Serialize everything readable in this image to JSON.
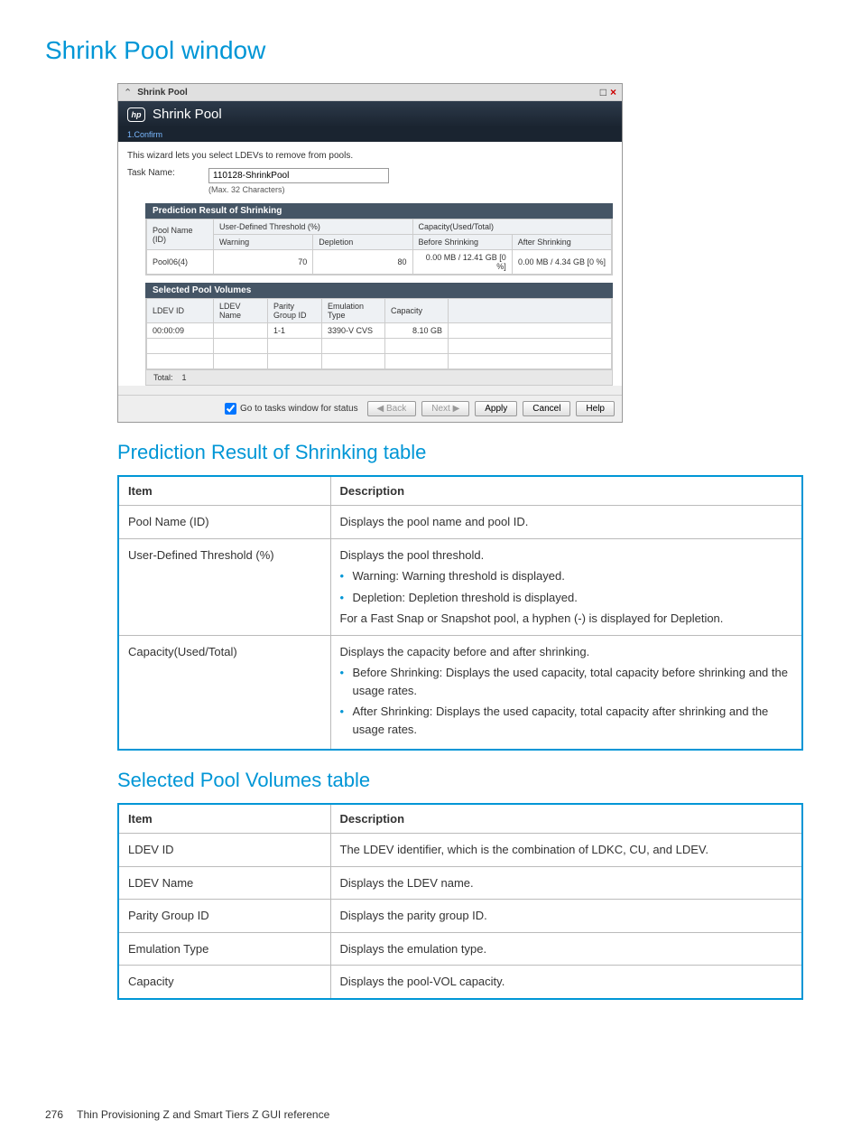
{
  "page": {
    "title": "Shrink Pool window",
    "section1_title": "Prediction Result of Shrinking table",
    "section2_title": "Selected Pool Volumes table",
    "footer_page": "276",
    "footer_text": "Thin Provisioning Z and Smart Tiers Z GUI reference"
  },
  "wizard": {
    "titlebar_text": "Shrink Pool",
    "brand_text": "Shrink Pool",
    "step_label": "1.Confirm",
    "instruction": "This wizard lets you select LDEVs to remove from pools.",
    "task_name_label": "Task Name:",
    "task_name_value": "110128-ShrinkPool",
    "task_name_hint": "(Max. 32 Characters)",
    "prediction": {
      "header": "Prediction Result of Shrinking",
      "col_pool_name": "Pool Name (ID)",
      "col_user_thresh": "User-Defined Threshold (%)",
      "col_warning": "Warning",
      "col_depletion": "Depletion",
      "col_capacity": "Capacity(Used/Total)",
      "col_before": "Before Shrinking",
      "col_after": "After Shrinking",
      "row": {
        "pool": "Pool06(4)",
        "warning": "70",
        "depletion": "80",
        "before": "0.00 MB / 12.41 GB [0 %]",
        "after": "0.00 MB / 4.34 GB [0 %]"
      }
    },
    "selected": {
      "header": "Selected Pool Volumes",
      "col_ldev_id": "LDEV ID",
      "col_ldev_name": "LDEV Name",
      "col_parity": "Parity Group ID",
      "col_emu": "Emulation Type",
      "col_capacity": "Capacity",
      "row": {
        "ldev_id": "00:00:09",
        "ldev_name": "",
        "parity": "1-1",
        "emu": "3390-V CVS",
        "capacity": "8.10 GB"
      },
      "total_label": "Total:",
      "total_value": "1"
    },
    "footer": {
      "checkbox_label": "Go to tasks window for status",
      "back": "Back",
      "next": "Next",
      "apply": "Apply",
      "cancel": "Cancel",
      "help": "Help"
    }
  },
  "table1": {
    "h_item": "Item",
    "h_desc": "Description",
    "rows": [
      {
        "item": "Pool Name (ID)",
        "desc_text": "Displays the pool name and pool ID."
      },
      {
        "item": "User-Defined Threshold (%)",
        "desc_intro": "Displays the pool threshold.",
        "bullets": [
          "Warning: Warning threshold is displayed.",
          "Depletion: Depletion threshold is displayed."
        ],
        "desc_outro": "For a Fast Snap or Snapshot pool, a hyphen (-) is displayed for Depletion."
      },
      {
        "item": "Capacity(Used/Total)",
        "desc_intro": "Displays the capacity before and after shrinking.",
        "bullets": [
          "Before Shrinking: Displays the used capacity, total capacity before shrinking and the usage rates.",
          "After Shrinking: Displays the used capacity, total capacity after shrinking and the usage rates."
        ]
      }
    ]
  },
  "table2": {
    "h_item": "Item",
    "h_desc": "Description",
    "rows": [
      {
        "item": "LDEV ID",
        "desc": "The LDEV identifier, which is the combination of LDKC, CU, and LDEV."
      },
      {
        "item": "LDEV Name",
        "desc": "Displays the LDEV name."
      },
      {
        "item": "Parity Group ID",
        "desc": "Displays the parity group ID."
      },
      {
        "item": "Emulation Type",
        "desc": "Displays the emulation type."
      },
      {
        "item": "Capacity",
        "desc": "Displays the pool-VOL capacity."
      }
    ]
  }
}
